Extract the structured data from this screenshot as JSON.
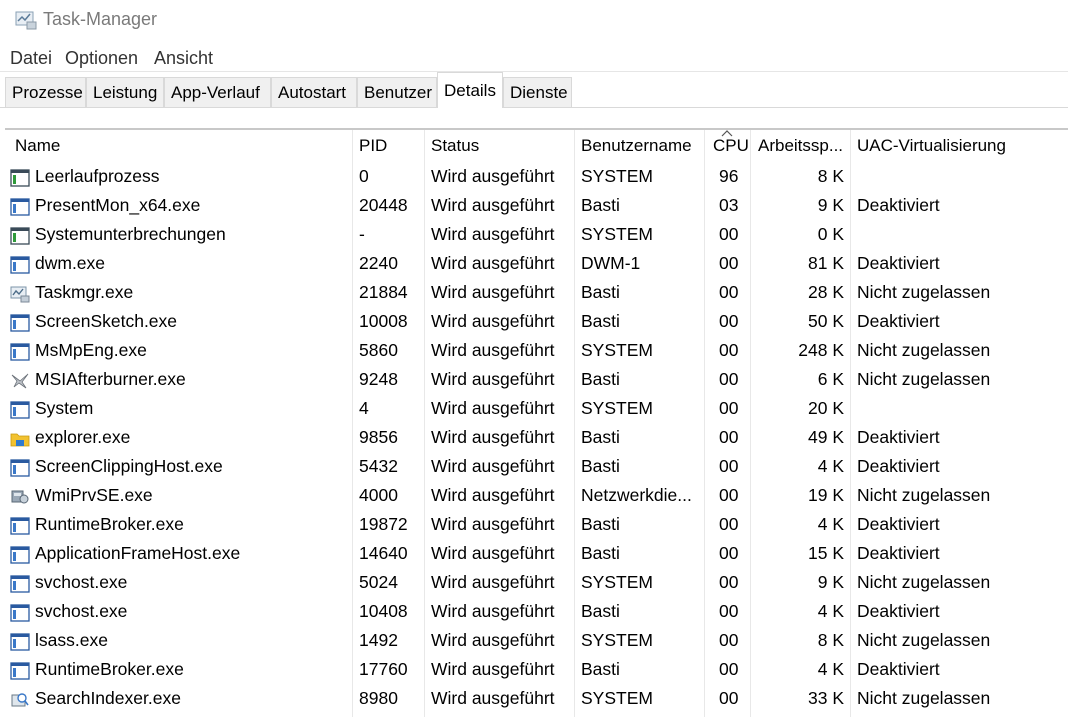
{
  "window": {
    "title": "Task-Manager"
  },
  "menu": [
    "Datei",
    "Optionen",
    "Ansicht"
  ],
  "tabs": [
    "Prozesse",
    "Leistung",
    "App-Verlauf",
    "Autostart",
    "Benutzer",
    "Details",
    "Dienste"
  ],
  "active_tab": "Details",
  "columns": {
    "name": "Name",
    "pid": "PID",
    "status": "Status",
    "user": "Benutzername",
    "cpu": "CPU",
    "mem": "Arbeitssp...",
    "uac": "UAC-Virtualisierung"
  },
  "sort_indicator": "^",
  "processes": [
    {
      "name": "Leerlaufprozess",
      "pid": "0",
      "status": "Wird ausgeführt",
      "user": "SYSTEM",
      "cpu": "96",
      "mem": "8 K",
      "uac": "",
      "icon": "process-window-icon"
    },
    {
      "name": "PresentMon_x64.exe",
      "pid": "20448",
      "status": "Wird ausgeführt",
      "user": "Basti",
      "cpu": "03",
      "mem": "9 K",
      "uac": "Deaktiviert",
      "icon": "app-window-icon"
    },
    {
      "name": "Systemunterbrechungen",
      "pid": "-",
      "status": "Wird ausgeführt",
      "user": "SYSTEM",
      "cpu": "00",
      "mem": "0 K",
      "uac": "",
      "icon": "process-window-icon"
    },
    {
      "name": "dwm.exe",
      "pid": "2240",
      "status": "Wird ausgeführt",
      "user": "DWM-1",
      "cpu": "00",
      "mem": "81 K",
      "uac": "Deaktiviert",
      "icon": "app-window-icon"
    },
    {
      "name": "Taskmgr.exe",
      "pid": "21884",
      "status": "Wird ausgeführt",
      "user": "Basti",
      "cpu": "00",
      "mem": "28 K",
      "uac": "Nicht zugelassen",
      "icon": "task-manager-icon"
    },
    {
      "name": "ScreenSketch.exe",
      "pid": "10008",
      "status": "Wird ausgeführt",
      "user": "Basti",
      "cpu": "00",
      "mem": "50 K",
      "uac": "Deaktiviert",
      "icon": "app-window-icon"
    },
    {
      "name": "MsMpEng.exe",
      "pid": "5860",
      "status": "Wird ausgeführt",
      "user": "SYSTEM",
      "cpu": "00",
      "mem": "248 K",
      "uac": "Nicht zugelassen",
      "icon": "app-window-icon"
    },
    {
      "name": "MSIAfterburner.exe",
      "pid": "9248",
      "status": "Wird ausgeführt",
      "user": "Basti",
      "cpu": "00",
      "mem": "6 K",
      "uac": "Nicht zugelassen",
      "icon": "airplane-icon"
    },
    {
      "name": "System",
      "pid": "4",
      "status": "Wird ausgeführt",
      "user": "SYSTEM",
      "cpu": "00",
      "mem": "20 K",
      "uac": "",
      "icon": "app-window-icon"
    },
    {
      "name": "explorer.exe",
      "pid": "9856",
      "status": "Wird ausgeführt",
      "user": "Basti",
      "cpu": "00",
      "mem": "49 K",
      "uac": "Deaktiviert",
      "icon": "folder-icon"
    },
    {
      "name": "ScreenClippingHost.exe",
      "pid": "5432",
      "status": "Wird ausgeführt",
      "user": "Basti",
      "cpu": "00",
      "mem": "4 K",
      "uac": "Deaktiviert",
      "icon": "app-window-icon"
    },
    {
      "name": "WmiPrvSE.exe",
      "pid": "4000",
      "status": "Wird ausgeführt",
      "user": "Netzwerkdie...",
      "cpu": "00",
      "mem": "19 K",
      "uac": "Nicht zugelassen",
      "icon": "wmi-icon"
    },
    {
      "name": "RuntimeBroker.exe",
      "pid": "19872",
      "status": "Wird ausgeführt",
      "user": "Basti",
      "cpu": "00",
      "mem": "4 K",
      "uac": "Deaktiviert",
      "icon": "app-window-icon"
    },
    {
      "name": "ApplicationFrameHost.exe",
      "pid": "14640",
      "status": "Wird ausgeführt",
      "user": "Basti",
      "cpu": "00",
      "mem": "15 K",
      "uac": "Deaktiviert",
      "icon": "app-window-icon"
    },
    {
      "name": "svchost.exe",
      "pid": "5024",
      "status": "Wird ausgeführt",
      "user": "SYSTEM",
      "cpu": "00",
      "mem": "9 K",
      "uac": "Nicht zugelassen",
      "icon": "app-window-icon"
    },
    {
      "name": "svchost.exe",
      "pid": "10408",
      "status": "Wird ausgeführt",
      "user": "Basti",
      "cpu": "00",
      "mem": "4 K",
      "uac": "Deaktiviert",
      "icon": "app-window-icon"
    },
    {
      "name": "lsass.exe",
      "pid": "1492",
      "status": "Wird ausgeführt",
      "user": "SYSTEM",
      "cpu": "00",
      "mem": "8 K",
      "uac": "Nicht zugelassen",
      "icon": "app-window-icon"
    },
    {
      "name": "RuntimeBroker.exe",
      "pid": "17760",
      "status": "Wird ausgeführt",
      "user": "Basti",
      "cpu": "00",
      "mem": "4 K",
      "uac": "Deaktiviert",
      "icon": "app-window-icon"
    },
    {
      "name": "SearchIndexer.exe",
      "pid": "8980",
      "status": "Wird ausgeführt",
      "user": "SYSTEM",
      "cpu": "00",
      "mem": "33 K",
      "uac": "Nicht zugelassen",
      "icon": "search-indexer-icon"
    }
  ]
}
